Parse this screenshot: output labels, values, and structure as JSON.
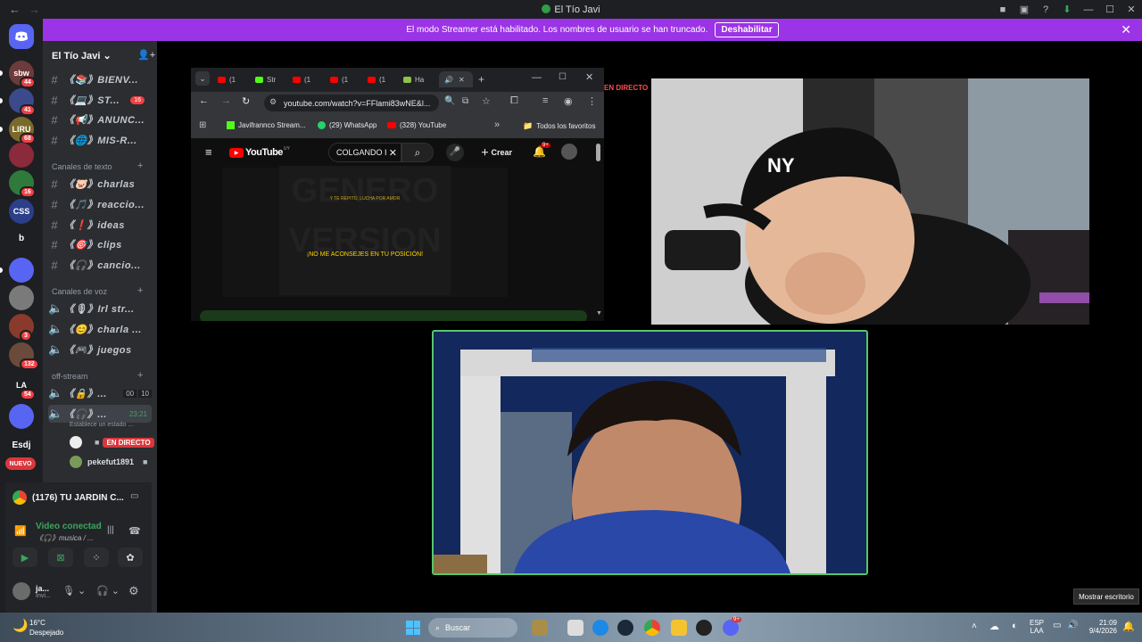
{
  "window": {
    "title": "El Tío Javi"
  },
  "banner": {
    "text": "El modo Streamer está habilitado. Los nombres de usuario se han truncado.",
    "button": "Deshabilitar"
  },
  "rail": {
    "servers": [
      {
        "label": "sbw",
        "badge": "44",
        "color": "#6d3b3b"
      },
      {
        "label": "",
        "badge": "41",
        "color": "#3b4a8a"
      },
      {
        "label": "LIRU",
        "badge": "68",
        "color": "#7a6a2a"
      },
      {
        "label": "",
        "badge": "",
        "color": "#8a2a3a"
      },
      {
        "label": "",
        "badge": "16",
        "color": "#2f7a3b"
      },
      {
        "label": "CSS",
        "badge": "",
        "color": "#2b3f8a"
      },
      {
        "label": "b",
        "badge": "",
        "color": "#1e1f22"
      },
      {
        "label": "",
        "badge": "",
        "color": "#5865f2"
      },
      {
        "label": "",
        "badge": "",
        "color": "#7a7a7a"
      },
      {
        "label": "",
        "badge": "3",
        "color": "#8a3a2a"
      },
      {
        "label": "",
        "badge": "132",
        "color": "#6a4a3a"
      },
      {
        "label": "LA",
        "badge": "54",
        "color": "#1e1f22"
      },
      {
        "label": "",
        "badge": "",
        "color": "#5865f2"
      },
      {
        "label": "Esdj",
        "badge": "",
        "color": "#1e1f22"
      },
      {
        "label": "NUEVO",
        "badge": "",
        "color": "#da373c"
      }
    ]
  },
  "sidebar": {
    "server_name": "El Tío Javi",
    "top_channels": [
      {
        "label": "《📚》BIENV...",
        "count": ""
      },
      {
        "label": "《💻》ST...",
        "count": "16"
      },
      {
        "label": "《📢》ANUNC...",
        "count": ""
      },
      {
        "label": "《🌐》MIS-R...",
        "count": ""
      }
    ],
    "cat_text": "Canales de texto",
    "text_channels": [
      {
        "label": "《🐷》charlas"
      },
      {
        "label": "《🎵》reaccio..."
      },
      {
        "label": "《❗》ideas"
      },
      {
        "label": "《🎯》clips"
      },
      {
        "label": "《🎧》cancio..."
      }
    ],
    "cat_voice": "Canales de voz",
    "voice_channels": [
      {
        "label": "《🎙》Irl str..."
      },
      {
        "label": "《😊》charla ..."
      },
      {
        "label": "《🎮》juegos"
      }
    ],
    "cat_offstream": "off-stream",
    "off_channels": [
      {
        "label": "《🔒》...",
        "meta": "00",
        "meta2": "10"
      },
      {
        "label": "《🎧》...",
        "meta": "23:21",
        "meta2": ""
      }
    ],
    "status_hint": "Establece un estado ...",
    "users": [
      {
        "name": "",
        "live": "EN DIRECTO"
      },
      {
        "name": "pekefut1891",
        "live": ""
      }
    ]
  },
  "voicepanel": {
    "activity": "(1176) TU JARDIN C...",
    "status": "Video conectad",
    "channel": "《🎧》musica / ...",
    "user_name": "ja...",
    "user_status": "Invi..."
  },
  "chrome": {
    "tabs": [
      "(1",
      "Str",
      "(1",
      "(1",
      "(1",
      "Ha"
    ],
    "url": "youtube.com/watch?v=FFlami83wNE&l...",
    "bookmarks": [
      "Javifrannco Stream...",
      "(29) WhatsApp",
      "(328) YouTube"
    ],
    "favorites": "Todos los favoritos",
    "yt_logo": "YouTube",
    "yt_region": "UY",
    "search_value": "COLGANDO I",
    "create": "Crear",
    "notif": "9+",
    "video_caption": "¡NO ME ACONSEJES EN TU POSICIÓN!",
    "video_top": "Y TE REPITO, LUCHA POR AMOR"
  },
  "overlay": {
    "live_text": "EN DIRECTO"
  },
  "taskbar": {
    "weather_temp": "16°C",
    "weather_desc": "Despejado",
    "search": "Buscar",
    "lang1": "ESP",
    "lang2": "LAA",
    "time": "21:09",
    "date": "9/4/2026",
    "tooltip": "Mostrar escritorio",
    "discord_badge": "9+"
  }
}
